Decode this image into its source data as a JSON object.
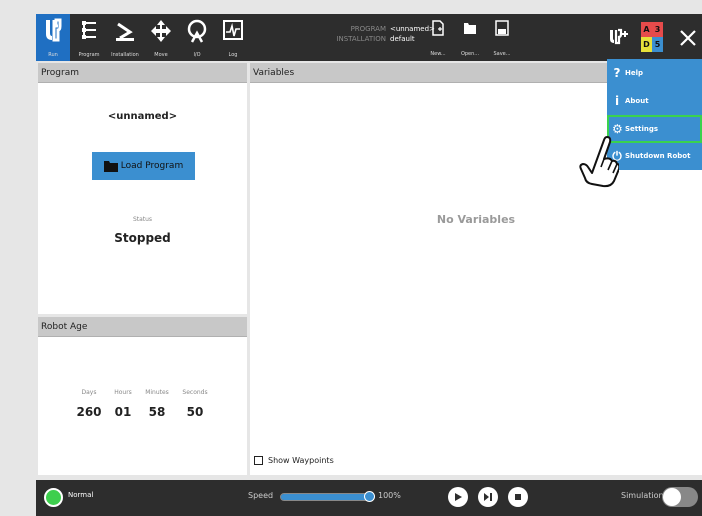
{
  "nav": {
    "items": [
      {
        "label": "Run",
        "icon": "ur-logo-icon"
      },
      {
        "label": "Program",
        "icon": "program-icon"
      },
      {
        "label": "Installation",
        "icon": "installation-icon"
      },
      {
        "label": "Move",
        "icon": "move-icon"
      },
      {
        "label": "I/O",
        "icon": "io-icon"
      },
      {
        "label": "Log",
        "icon": "log-icon"
      }
    ]
  },
  "program_info": {
    "program_key": "PROGRAM",
    "program_value": "<unnamed>",
    "installation_key": "INSTALLATION",
    "installation_value": "default"
  },
  "file_buttons": {
    "new_label": "New...",
    "open_label": "Open...",
    "save_label": "Save..."
  },
  "abcd": {
    "a": "A",
    "three": "3",
    "d": "D",
    "five": "5"
  },
  "program_panel": {
    "title": "Program",
    "name": "<unnamed>",
    "load_label": "Load Program",
    "status_label": "Status",
    "status_value": "Stopped"
  },
  "age_panel": {
    "title": "Robot Age",
    "days_label": "Days",
    "days": "260",
    "hours_label": "Hours",
    "hours": "01",
    "minutes_label": "Minutes",
    "minutes": "58",
    "seconds_label": "Seconds",
    "seconds": "50"
  },
  "vars_panel": {
    "title": "Variables",
    "empty_text": "No Variables",
    "show_waypoints_label": "Show Waypoints"
  },
  "menu": {
    "items": [
      {
        "label": "Help",
        "icon": "help-icon"
      },
      {
        "label": "About",
        "icon": "info-icon"
      },
      {
        "label": "Settings",
        "icon": "gear-icon"
      },
      {
        "label": "Shutdown Robot",
        "icon": "power-icon"
      }
    ]
  },
  "bottom": {
    "status_label": "Normal",
    "speed_label": "Speed",
    "speed_value": "100%",
    "speed_fraction": 1.0,
    "simulation_label": "Simulation"
  },
  "colors": {
    "accent": "#3b8fd0",
    "status_ok": "#3ecf4e",
    "highlight": "#3ad24e"
  }
}
